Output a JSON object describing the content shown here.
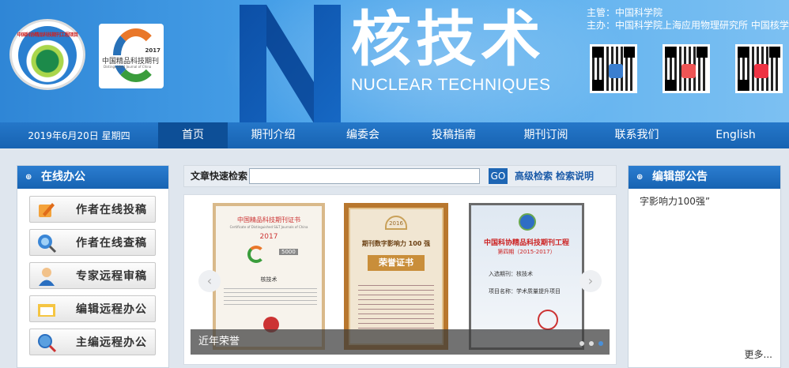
{
  "header": {
    "title_cn": "核技术",
    "title_en": "NUCLEAR TECHNIQUES",
    "competent": "主管：中国科学院",
    "sponsor": "主办：中国科学院上海应用物理研究所 中国核学会",
    "logo1_text": "中国科协精品科技期刊工程项目",
    "logo2_title": "中国精品科技期刊",
    "logo2_year": "2017",
    "logo2_sub": "Distinguished Journal of China",
    "qr_codes": [
      {
        "name": "qr-code-1",
        "badge_color": "#3b7fd0"
      },
      {
        "name": "qr-code-2",
        "badge_color": "#e55"
      },
      {
        "name": "qr-code-3-weibo",
        "badge_color": "#e34"
      }
    ],
    "colors": {
      "banner": "#3d95e0",
      "nav": "#1e6bbd",
      "accent": "#1763b2"
    }
  },
  "nav": {
    "date": "2019年6月20日 星期四",
    "items": [
      {
        "label": "首页",
        "active": true
      },
      {
        "label": "期刊介绍",
        "active": false
      },
      {
        "label": "编委会",
        "active": false
      },
      {
        "label": "投稿指南",
        "active": false
      },
      {
        "label": "期刊订阅",
        "active": false
      },
      {
        "label": "联系我们",
        "active": false
      },
      {
        "label": "English",
        "active": false
      }
    ]
  },
  "online_office": {
    "title": "在线办公",
    "buttons": [
      {
        "label": "作者在线投稿",
        "icon": "pencil-icon"
      },
      {
        "label": "作者在线查稿",
        "icon": "search-globe-icon"
      },
      {
        "label": "专家远程审稿",
        "icon": "person-icon"
      },
      {
        "label": "编辑远程办公",
        "icon": "folder-icon"
      },
      {
        "label": "主编远程办公",
        "icon": "magnifier-icon"
      }
    ]
  },
  "search": {
    "label": "文章快速检索",
    "placeholder": "",
    "go_label": "GO",
    "advanced_label": "高级检索",
    "help_label": "检索说明"
  },
  "slider": {
    "caption": "近年荣誉",
    "cert1_title": "中国精品科技期刊证书",
    "cert1_sub": "Certificate of Distinguished S&T Journals of China",
    "cert1_year": "2017",
    "cert1_name": "核技术",
    "cert1_badge": "5000",
    "cert2_year": "2016",
    "cert2_title": "期刊数字影响力 100 强",
    "cert2_honor": "荣誉证书",
    "cert3_title": "中国科协精品科技期刊工程",
    "cert3_sub": "第四期（2015-2017）",
    "cert3_line1": "入选期刊：核技术",
    "cert3_line2": "项目名称：学术质量提升项目",
    "dots": 3,
    "active_dot": 2
  },
  "notice": {
    "title": "编辑部公告",
    "text": "字影响力100强”",
    "more_label": "更多..."
  }
}
